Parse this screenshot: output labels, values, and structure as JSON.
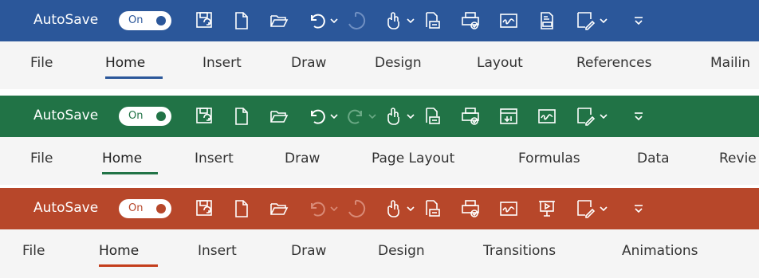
{
  "word": {
    "autosave_label": "AutoSave",
    "toggle_state": "On",
    "accent": "#2b579a",
    "underline": "#2b579a",
    "tabs": [
      "File",
      "Home",
      "Insert",
      "Draw",
      "Design",
      "Layout",
      "References",
      "Mailin"
    ]
  },
  "excel": {
    "autosave_label": "AutoSave",
    "toggle_state": "On",
    "accent": "#217346",
    "underline": "#217346",
    "tabs": [
      "File",
      "Home",
      "Insert",
      "Draw",
      "Page Layout",
      "Formulas",
      "Data",
      "Revie"
    ]
  },
  "powerpoint": {
    "autosave_label": "AutoSave",
    "toggle_state": "On",
    "accent": "#b7472a",
    "underline": "#c43e1c",
    "tabs": [
      "File",
      "Home",
      "Insert",
      "Draw",
      "Design",
      "Transitions",
      "Animations"
    ]
  }
}
